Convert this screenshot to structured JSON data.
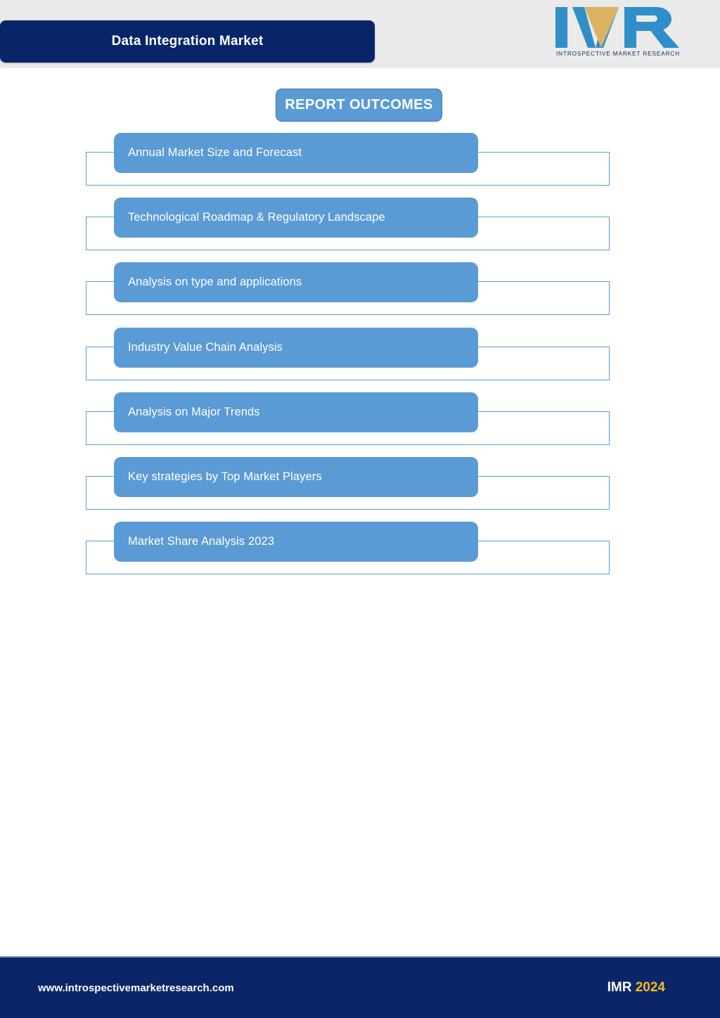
{
  "header": {
    "title": "Data Integration Market",
    "logo": {
      "mark_letters": "IMR",
      "tagline": "INTROSPECTIVE MARKET RESEARCH",
      "icon_name": "imr-logo-icon"
    }
  },
  "main": {
    "section_title": "REPORT OUTCOMES",
    "outcomes": [
      {
        "label": "Annual Market Size and Forecast"
      },
      {
        "label": "Technological Roadmap & Regulatory Landscape"
      },
      {
        "label": "Analysis on type and applications"
      },
      {
        "label": "Industry Value Chain Analysis"
      },
      {
        "label": "Analysis on Major Trends"
      },
      {
        "label": "Key strategies by Top Market Players"
      },
      {
        "label": "Market Share Analysis 2023"
      }
    ]
  },
  "footer": {
    "url": "www.introspectivemarketresearch.com",
    "brand": "IMR",
    "year": "2024"
  },
  "colors": {
    "navy": "#0b2568",
    "accent_blue": "#5b9bd5",
    "accent_blue_dark": "#41719c",
    "gold": "#f5b921",
    "header_band": "#eaeaea"
  }
}
